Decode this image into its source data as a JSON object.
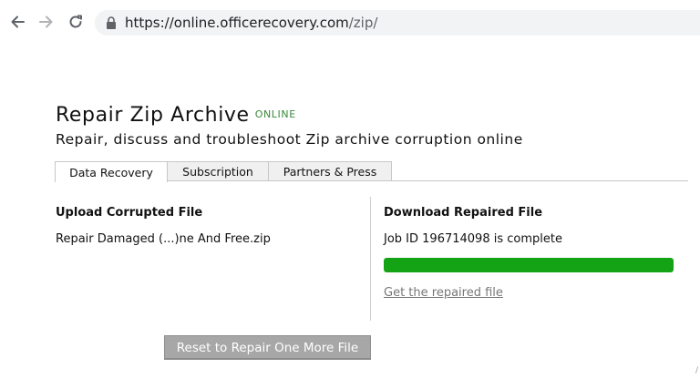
{
  "browser": {
    "url_host": "https://online.officerecovery.com",
    "url_path": "/zip/",
    "icons": [
      "back-arrow-icon",
      "forward-arrow-icon",
      "reload-icon",
      "lock-icon"
    ]
  },
  "page": {
    "title": "Repair Zip Archive",
    "badge": "ONLINE",
    "subtitle": "Repair, discuss and troubleshoot Zip archive corruption online",
    "accent_color": "#14a314"
  },
  "tabs": [
    {
      "label": "Data Recovery",
      "active": true
    },
    {
      "label": "Subscription",
      "active": false
    },
    {
      "label": "Partners & Press",
      "active": false
    }
  ],
  "upload": {
    "heading": "Upload Corrupted File",
    "filename": "Repair Damaged (...)ne And Free.zip"
  },
  "download": {
    "heading": "Download Repaired File",
    "status": "Job ID 196714098 is complete",
    "progress_percent": 100,
    "link_label": "Get the repaired file"
  },
  "actions": {
    "reset_label": "Reset to Repair One More File"
  }
}
